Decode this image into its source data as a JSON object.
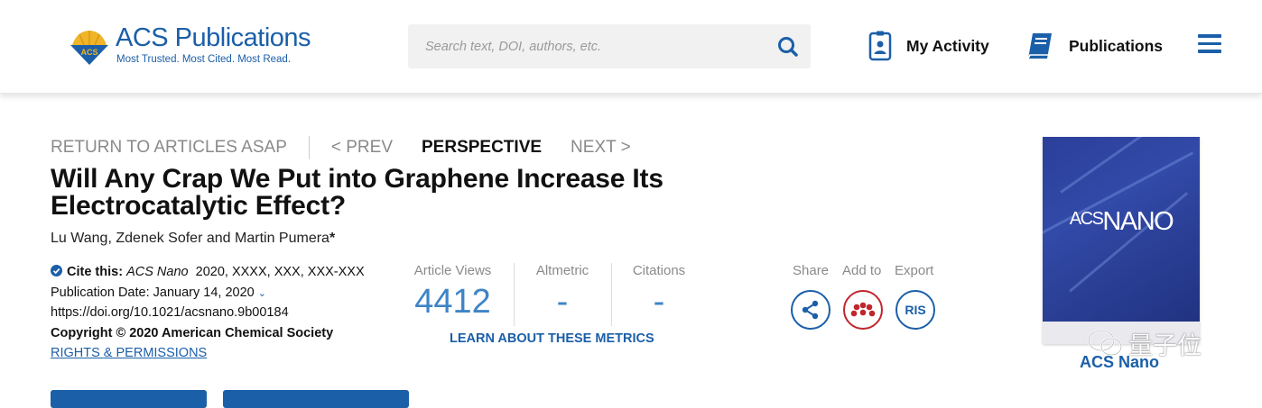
{
  "header": {
    "logo_name": "ACS Publications",
    "logo_tagline": "Most Trusted. Most Cited. Most Read.",
    "logo_emblem_text": "ACS",
    "search_placeholder": "Search text, DOI, authors, etc.",
    "my_activity_label": "My Activity",
    "publications_label": "Publications",
    "accent_color": "#1b5fa8"
  },
  "article_nav": {
    "return_label": "RETURN TO ARTICLES ASAP",
    "prev_label": "< PREV",
    "type_label": "PERSPECTIVE",
    "next_label": "NEXT >"
  },
  "article": {
    "title": "Will Any Crap We Put into Graphene Increase Its Electrocatalytic Effect?",
    "authors": [
      "Lu Wang,",
      "Zdenek Sofer",
      "and",
      "Martin Pumera"
    ],
    "corresponding_mark": "*",
    "cite_label": "Cite this:",
    "cite_journal": "ACS Nano",
    "cite_rest": "2020, XXXX, XXX, XXX-XXX",
    "publication_date": "Publication Date: January 14, 2020",
    "doi": "https://doi.org/10.1021/acsnano.9b00184",
    "copyright": "Copyright © 2020 American Chemical Society",
    "rights_label": "RIGHTS & PERMISSIONS"
  },
  "metrics": {
    "views_label": "Article Views",
    "views_value": "4412",
    "altmetric_label": "Altmetric",
    "altmetric_value": "-",
    "citations_label": "Citations",
    "citations_value": "-",
    "learn_label": "LEARN ABOUT THESE METRICS"
  },
  "actions": {
    "share_label": "Share",
    "add_label": "Add to",
    "export_label": "Export",
    "ris_label": "RIS"
  },
  "journal": {
    "cover_acs": "ACS",
    "cover_nano": "NANO",
    "caption": "ACS Nano"
  },
  "watermark": {
    "text": "量子位"
  }
}
